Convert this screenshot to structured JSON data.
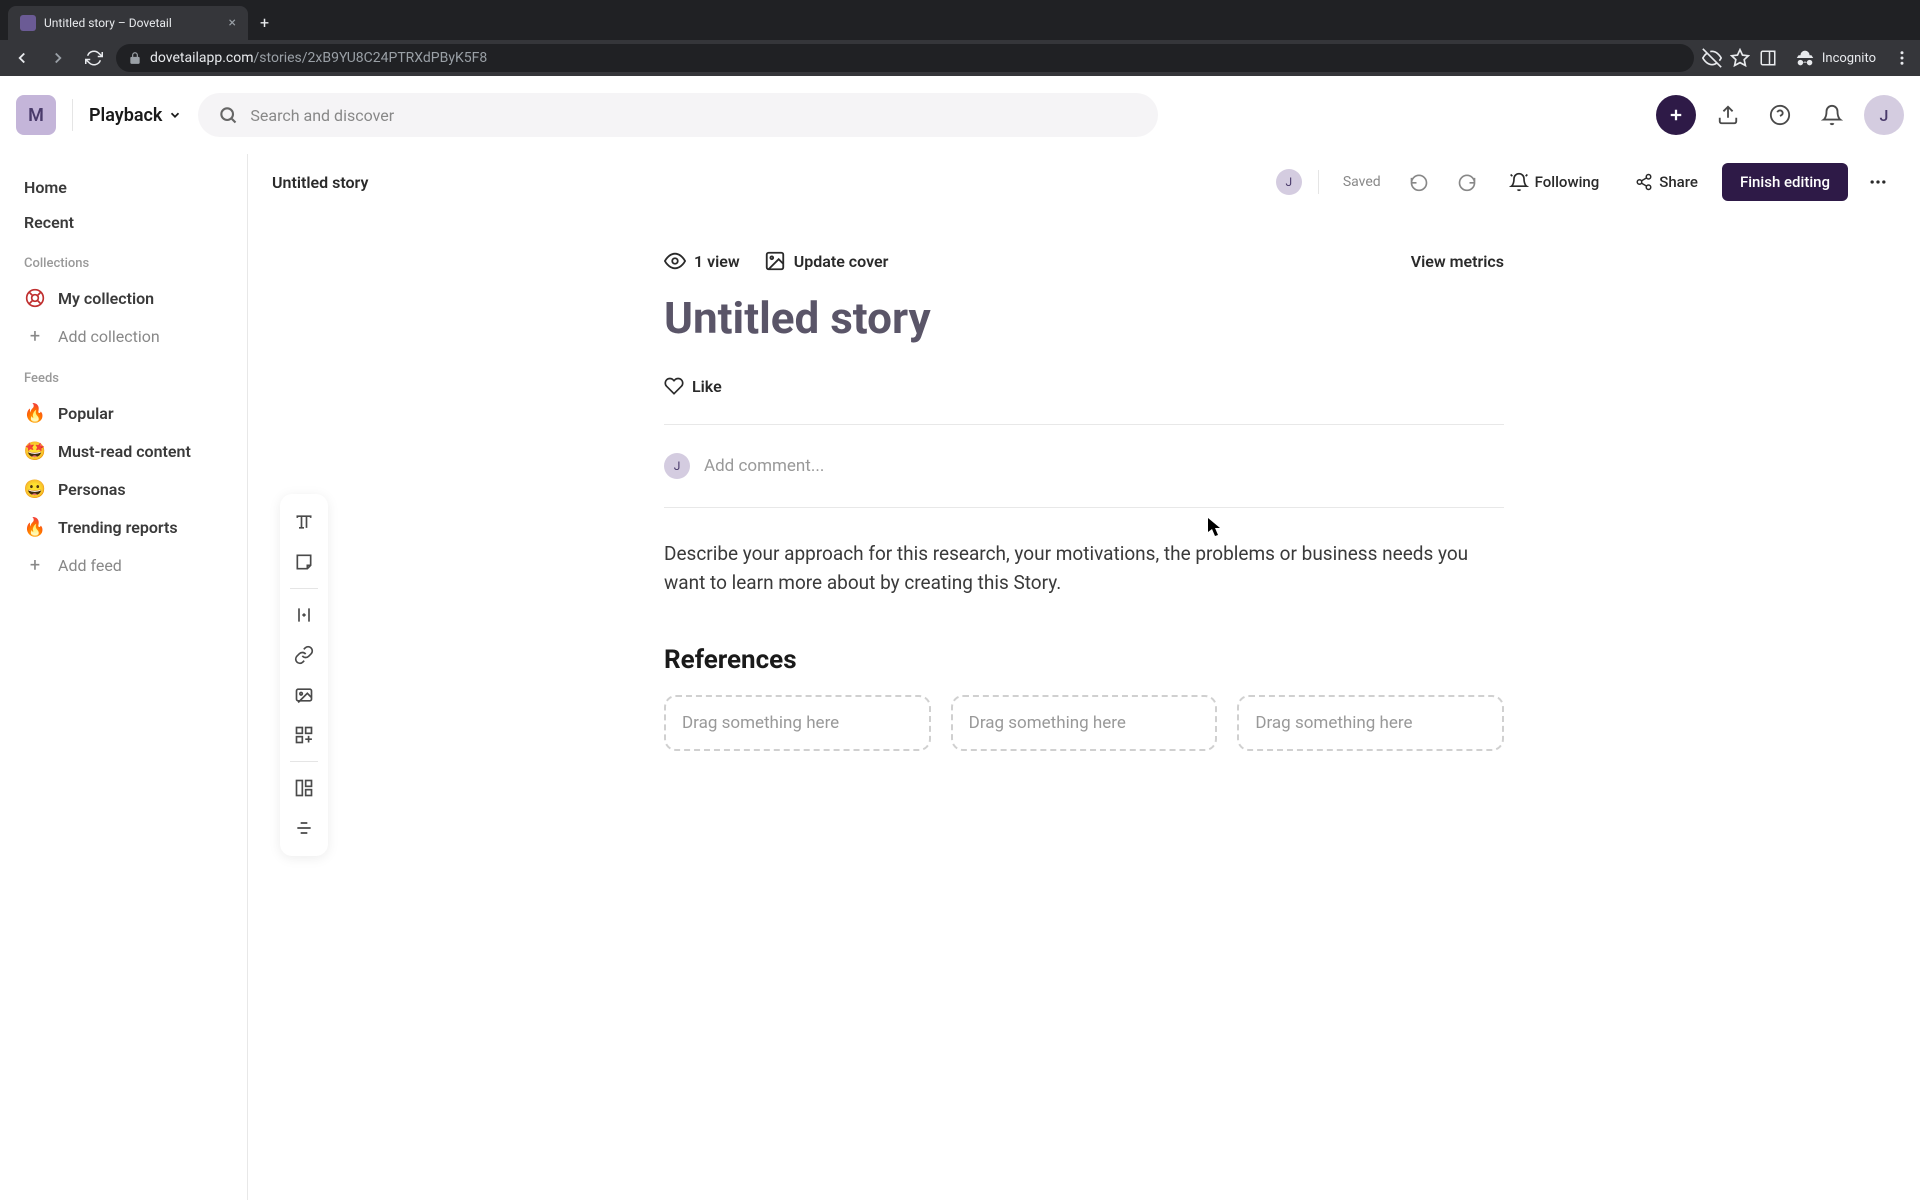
{
  "browser": {
    "tab_title": "Untitled story – Dovetail",
    "url_domain": "dovetailapp.com",
    "url_path": "/stories/2xB9YU8C24PTRXdPByK5F8",
    "incognito_label": "Incognito"
  },
  "header": {
    "workspace_initial": "M",
    "project_name": "Playback",
    "search_placeholder": "Search and discover",
    "user_initial": "J"
  },
  "sidebar": {
    "home": "Home",
    "recent": "Recent",
    "collections_label": "Collections",
    "collections": [
      {
        "label": "My collection",
        "icon": "lifebuoy"
      }
    ],
    "add_collection": "Add collection",
    "feeds_label": "Feeds",
    "feeds": [
      {
        "label": "Popular",
        "emoji": "🔥"
      },
      {
        "label": "Must-read content",
        "emoji": "🤩"
      },
      {
        "label": "Personas",
        "emoji": "😀"
      },
      {
        "label": "Trending reports",
        "emoji": "🔥"
      }
    ],
    "add_feed": "Add feed"
  },
  "content_header": {
    "breadcrumb": "Untitled story",
    "collaborator_initial": "J",
    "save_status": "Saved",
    "following_label": "Following",
    "share_label": "Share",
    "finish_label": "Finish editing"
  },
  "story": {
    "views_label": "1 view",
    "update_cover_label": "Update cover",
    "view_metrics_label": "View metrics",
    "title": "Untitled story",
    "like_label": "Like",
    "commenter_initial": "J",
    "comment_placeholder": "Add comment...",
    "description": "Describe your approach for this research, your motivations, the problems or business needs you want to learn more about by creating this Story.",
    "references_heading": "References",
    "drop_placeholder": "Drag something here"
  }
}
